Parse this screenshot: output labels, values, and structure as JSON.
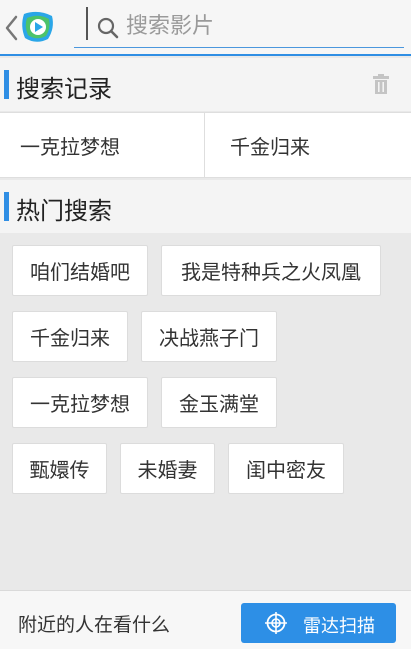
{
  "search": {
    "placeholder": "搜索影片"
  },
  "history": {
    "title": "搜索记录",
    "items": [
      {
        "label": "一克拉梦想"
      },
      {
        "label": "千金归来"
      }
    ]
  },
  "hot": {
    "title": "热门搜索",
    "tags": [
      {
        "label": "咱们结婚吧"
      },
      {
        "label": "我是特种兵之火凤凰"
      },
      {
        "label": "千金归来"
      },
      {
        "label": "决战燕子门"
      },
      {
        "label": "一克拉梦想"
      },
      {
        "label": "金玉满堂"
      },
      {
        "label": "甄嬛传"
      },
      {
        "label": "未婚妻"
      },
      {
        "label": "闺中密友"
      }
    ]
  },
  "footer": {
    "nearby_label": "附近的人在看什么",
    "radar_label": "雷达扫描"
  },
  "colors": {
    "accent": "#2f8ee4",
    "page_background": "#e9e9e9",
    "button_text": "#ffffff"
  },
  "icons": [
    "back-icon",
    "app-logo-icon",
    "search-icon",
    "trash-icon",
    "radar-icon"
  ]
}
